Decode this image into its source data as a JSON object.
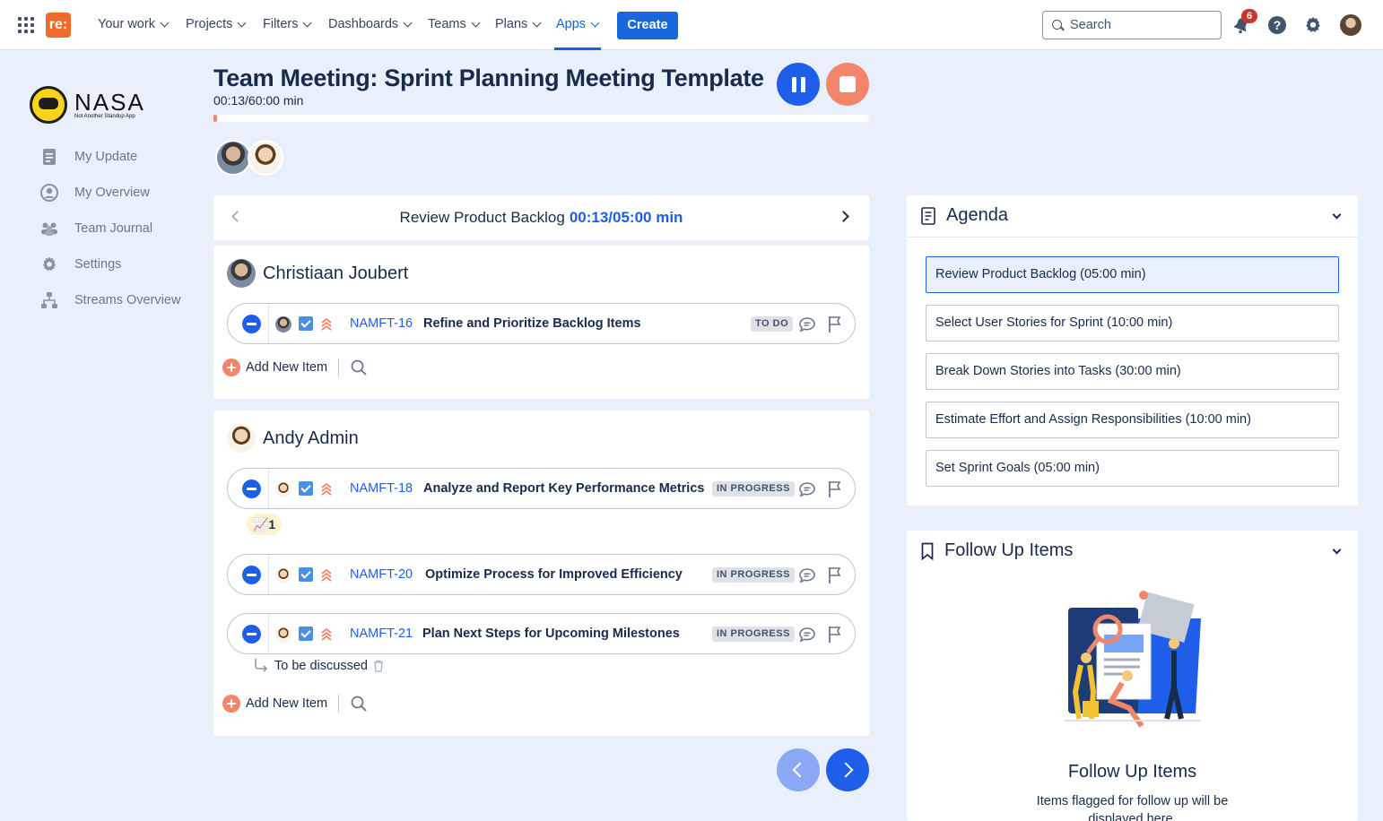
{
  "topnav": {
    "brand_letter": "re:",
    "items": [
      {
        "label": "Your work"
      },
      {
        "label": "Projects"
      },
      {
        "label": "Filters"
      },
      {
        "label": "Dashboards"
      },
      {
        "label": "Teams"
      },
      {
        "label": "Plans"
      },
      {
        "label": "Apps"
      }
    ],
    "create_label": "Create",
    "search_placeholder": "Search",
    "notification_count": "6",
    "help_glyph": "?"
  },
  "sidebar": {
    "logo_title": "NASA",
    "logo_subtitle": "Not Another Standup App",
    "items": [
      {
        "label": "My Update",
        "icon": "document-icon"
      },
      {
        "label": "My Overview",
        "icon": "user-circle-icon"
      },
      {
        "label": "Team Journal",
        "icon": "team-icon"
      },
      {
        "label": "Settings",
        "icon": "gear-icon"
      },
      {
        "label": "Streams Overview",
        "icon": "hierarchy-icon"
      }
    ]
  },
  "meeting": {
    "title": "Team Meeting: Sprint Planning Meeting Template",
    "timer": "00:13/60:00 min",
    "progress": 0.004
  },
  "topic": {
    "name": "Review Product Backlog",
    "time": "00:13/05:00 min"
  },
  "people": [
    {
      "name": "Christiaan Joubert",
      "items": [
        {
          "key": "NAMFT-16",
          "title": "Refine and Prioritize Backlog Items",
          "status": "TO DO"
        }
      ],
      "add_label": "Add New Item"
    },
    {
      "name": "Andy Admin",
      "items": [
        {
          "key": "NAMFT-18",
          "title": "Analyze and Report Key Performance Metrics",
          "status": "IN PROGRESS"
        },
        {
          "key": "NAMFT-20",
          "title": "Optimize Process for Improved Efficiency",
          "status": "IN PROGRESS"
        },
        {
          "key": "NAMFT-21",
          "title": "Plan Next Steps for Upcoming Milestones",
          "status": "IN PROGRESS"
        }
      ],
      "reaction": "📈1",
      "note": "To be discussed",
      "add_label": "Add New Item"
    }
  ],
  "agenda": {
    "title": "Agenda",
    "items": [
      {
        "label": "Review Product Backlog (05:00 min)"
      },
      {
        "label": "Select User Stories for Sprint (10:00 min)"
      },
      {
        "label": "Break Down Stories into Tasks (30:00 min)"
      },
      {
        "label": "Estimate Effort and Assign Responsibilities (10:00 min)"
      },
      {
        "label": "Set Sprint Goals (05:00 min)"
      }
    ]
  },
  "follow_up": {
    "title": "Follow Up Items",
    "empty_title": "Follow Up Items",
    "empty_desc": "Items flagged for follow up will be displayed here."
  },
  "colors": {
    "primary": "#1f5ee8",
    "accent": "#f2866a",
    "background": "#e9f0fb"
  }
}
